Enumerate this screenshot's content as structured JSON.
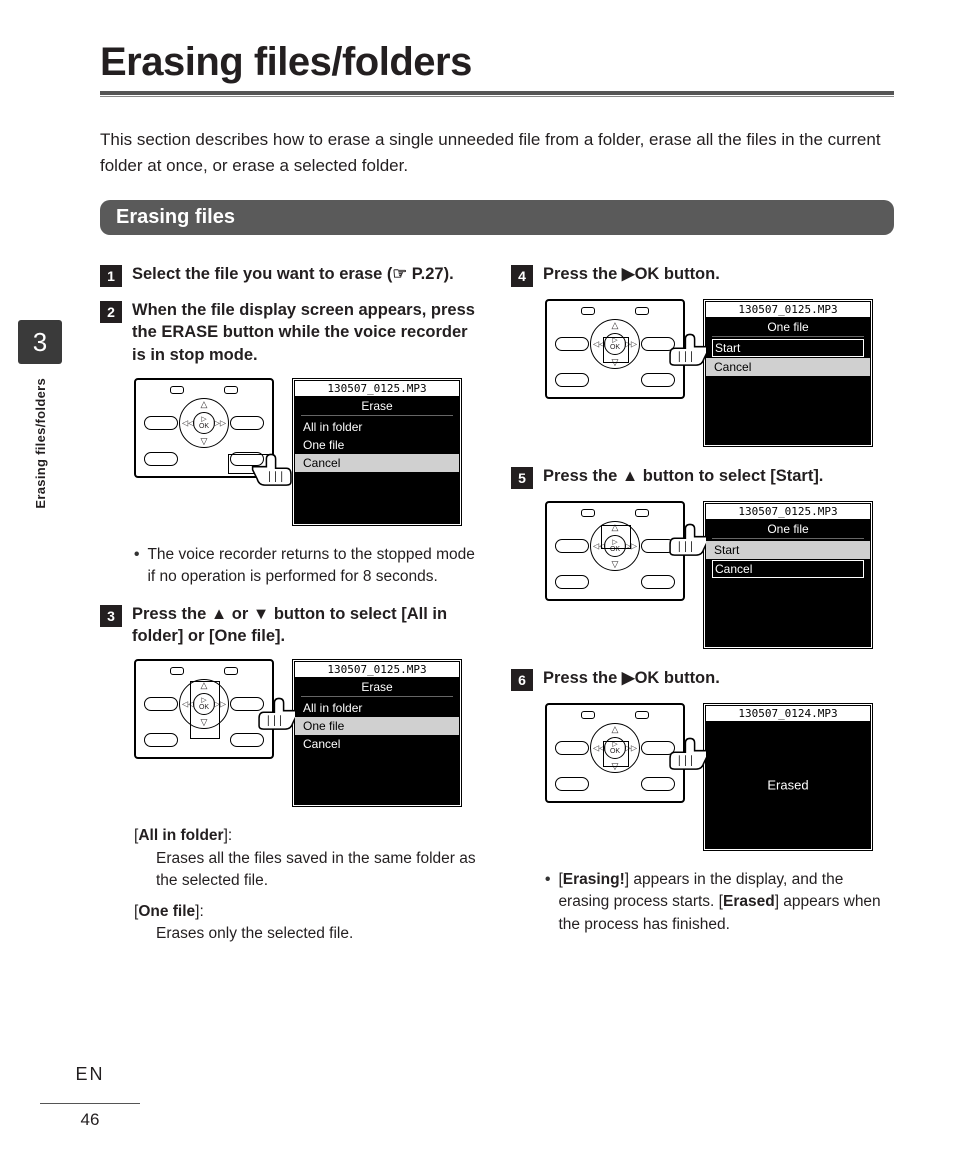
{
  "title": "Erasing files/folders",
  "intro": "This section describes how to erase a single unneeded file from a folder, erase all the files in the current folder at once, or erase a selected folder.",
  "section_header": "Erasing files",
  "side": {
    "chapter": "3",
    "label": "Erasing files/folders"
  },
  "footer": {
    "lang": "EN",
    "page": "46"
  },
  "steps": {
    "s1": {
      "pre": "Select the file you want to erase (☞ P.27)."
    },
    "s2": {
      "a": "When the file display screen appears, press the ",
      "b": "ERASE",
      "c": " button while the voice recorder is in stop mode."
    },
    "s2_note": "The voice recorder returns to the stopped mode if no operation is performed for 8 seconds.",
    "s3": {
      "a": "Press the ",
      "b": " or ",
      "c": " button to select [",
      "d": "All in folder",
      "e": "] or [",
      "f": "One file",
      "g": "]."
    },
    "s3_def1_term": "All in folder",
    "s3_def1_body": "Erases all the files saved in the same folder as the selected file.",
    "s3_def2_term": "One file",
    "s3_def2_body": "Erases only the selected file.",
    "s4": {
      "a": "Press the ",
      "b": "OK",
      "c": " button."
    },
    "s5": {
      "a": "Press the ",
      "b": " button to select [",
      "c": "Start",
      "d": "]."
    },
    "s6": {
      "a": "Press the ",
      "b": "OK",
      "c": " button."
    },
    "s6_note": {
      "a": "[",
      "b": "Erasing!",
      "c": "] appears in the display, and the erasing process starts. [",
      "d": "Erased",
      "e": "] appears when the process has finished."
    }
  },
  "screens": {
    "file1": "130507_0125.MP3",
    "file2": "130507_0124.MP3",
    "erase_title": "Erase",
    "onefile_title": "One file",
    "opt_all": "All in folder",
    "opt_one": "One file",
    "opt_cancel": "Cancel",
    "opt_start": "Start",
    "erased_msg": "Erased"
  },
  "glyphs": {
    "tri_up": "▲",
    "tri_down": "▼",
    "tri_right": "▶",
    "hand_point": "☞"
  }
}
